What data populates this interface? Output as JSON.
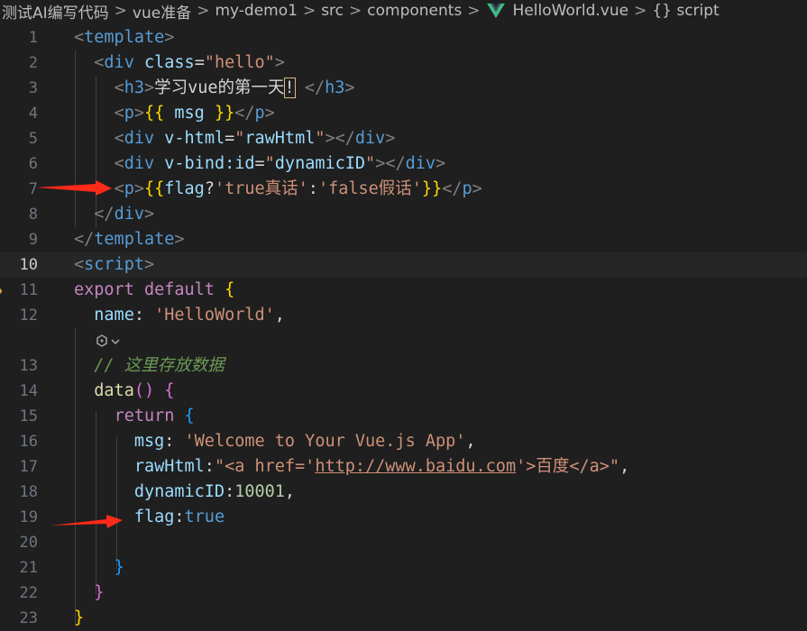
{
  "breadcrumb": {
    "items": [
      "测试AI编写代码",
      "vue准备",
      "my-demo1",
      "src",
      "components",
      "HelloWorld.vue",
      "{} script"
    ],
    "separator": ">"
  },
  "editor": {
    "lines": [
      {
        "n": "1",
        "code": "<template>"
      },
      {
        "n": "2",
        "code": "<div class=\"hello\">"
      },
      {
        "n": "3",
        "code": "<h3>学习vue的第一天!</h3>"
      },
      {
        "n": "4",
        "code": "<p>{{ msg }}</p>"
      },
      {
        "n": "5",
        "code": "<div v-html=\"rawHtml\"></div>"
      },
      {
        "n": "6",
        "code": "<div v-bind:id=\"dynamicID\"></div>"
      },
      {
        "n": "7",
        "code": "<p>{{flag?'true真话':'false假话'}}</p>"
      },
      {
        "n": "8",
        "code": "</div>"
      },
      {
        "n": "9",
        "code": "</template>"
      },
      {
        "n": "10",
        "code": "<script>"
      },
      {
        "n": "11",
        "code": "export default {"
      },
      {
        "n": "12",
        "code": "name: 'HelloWorld',"
      },
      {
        "n": "13",
        "code": "// 这里存放数据"
      },
      {
        "n": "14",
        "code": "data() {"
      },
      {
        "n": "15",
        "code": "return {"
      },
      {
        "n": "16",
        "code": "msg: 'Welcome to Your Vue.js App',"
      },
      {
        "n": "17",
        "code": "rawHtml:\"<a href='http://www.baidu.com'>百度</a>\","
      },
      {
        "n": "18",
        "code": "dynamicID:10001,"
      },
      {
        "n": "19",
        "code": "flag:true"
      },
      {
        "n": "20",
        "code": ""
      },
      {
        "n": "21",
        "code": "}"
      },
      {
        "n": "22",
        "code": "}"
      },
      {
        "n": "23",
        "code": "}"
      }
    ],
    "active_line": "10",
    "annotation_arrows_point_to": [
      "7",
      "19"
    ]
  },
  "colors": {
    "background": "#1f1f1f",
    "arrow": "#ff2a1a",
    "vue_green": "#41b883"
  },
  "icons": [
    "vue-logo-icon",
    "copilot-sparkle-icon",
    "chevron-down-icon",
    "red-arrow-annotation"
  ]
}
